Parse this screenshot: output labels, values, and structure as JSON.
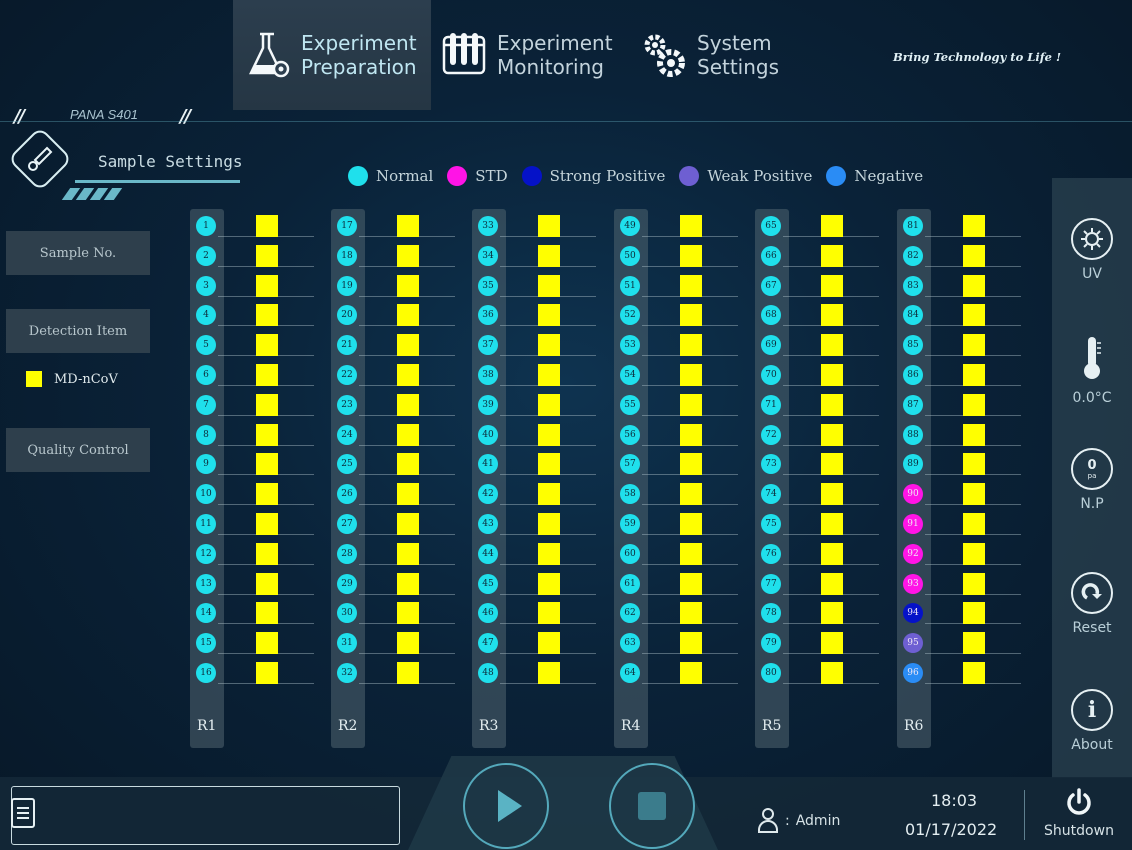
{
  "header": {
    "tabs": [
      {
        "label": "Experiment\nPreparation",
        "icon": "flask-gear-icon",
        "active": true
      },
      {
        "label": "Experiment\nMonitoring",
        "icon": "test-tube-rack-icon",
        "active": false
      },
      {
        "label": "System\nSettings",
        "icon": "gears-icon",
        "active": false
      }
    ],
    "slogan": "Bring Technology to Life !",
    "device": "PANA S401"
  },
  "section": {
    "title": "Sample Settings",
    "icon": "pipette-icon"
  },
  "legend": [
    {
      "label": "Normal",
      "color": "#1fe0ec"
    },
    {
      "label": "STD",
      "color": "#ff14e6"
    },
    {
      "label": "Strong Positive",
      "color": "#0512c8"
    },
    {
      "label": "Weak Positive",
      "color": "#6e5fd2"
    },
    {
      "label": "Negative",
      "color": "#2a8cf5"
    }
  ],
  "left_panel": {
    "sample_no": "Sample No.",
    "detection_item": "Detection Item",
    "detection_entry": {
      "label": "MD-nCoV",
      "color": "#ffff00"
    },
    "quality_control": "Quality Control"
  },
  "racks": [
    {
      "label": "R1",
      "slots": [
        "1",
        "2",
        "3",
        "4",
        "5",
        "6",
        "7",
        "8",
        "9",
        "10",
        "11",
        "12",
        "13",
        "14",
        "15",
        "16"
      ],
      "types": [
        "normal",
        "normal",
        "normal",
        "normal",
        "normal",
        "normal",
        "normal",
        "normal",
        "normal",
        "normal",
        "normal",
        "normal",
        "normal",
        "normal",
        "normal",
        "normal"
      ]
    },
    {
      "label": "R2",
      "slots": [
        "17",
        "18",
        "19",
        "20",
        "21",
        "22",
        "23",
        "24",
        "25",
        "26",
        "27",
        "28",
        "29",
        "30",
        "31",
        "32"
      ],
      "types": [
        "normal",
        "normal",
        "normal",
        "normal",
        "normal",
        "normal",
        "normal",
        "normal",
        "normal",
        "normal",
        "normal",
        "normal",
        "normal",
        "normal",
        "normal",
        "normal"
      ]
    },
    {
      "label": "R3",
      "slots": [
        "33",
        "34",
        "35",
        "36",
        "37",
        "38",
        "39",
        "40",
        "41",
        "42",
        "43",
        "44",
        "45",
        "46",
        "47",
        "48"
      ],
      "types": [
        "normal",
        "normal",
        "normal",
        "normal",
        "normal",
        "normal",
        "normal",
        "normal",
        "normal",
        "normal",
        "normal",
        "normal",
        "normal",
        "normal",
        "normal",
        "normal"
      ]
    },
    {
      "label": "R4",
      "slots": [
        "49",
        "50",
        "51",
        "52",
        "53",
        "54",
        "55",
        "56",
        "57",
        "58",
        "59",
        "60",
        "61",
        "62",
        "63",
        "64"
      ],
      "types": [
        "normal",
        "normal",
        "normal",
        "normal",
        "normal",
        "normal",
        "normal",
        "normal",
        "normal",
        "normal",
        "normal",
        "normal",
        "normal",
        "normal",
        "normal",
        "normal"
      ]
    },
    {
      "label": "R5",
      "slots": [
        "65",
        "66",
        "67",
        "68",
        "69",
        "70",
        "71",
        "72",
        "73",
        "74",
        "75",
        "76",
        "77",
        "78",
        "79",
        "80"
      ],
      "types": [
        "normal",
        "normal",
        "normal",
        "normal",
        "normal",
        "normal",
        "normal",
        "normal",
        "normal",
        "normal",
        "normal",
        "normal",
        "normal",
        "normal",
        "normal",
        "normal"
      ]
    },
    {
      "label": "R6",
      "slots": [
        "81",
        "82",
        "83",
        "84",
        "85",
        "86",
        "87",
        "88",
        "89",
        "90",
        "91",
        "92",
        "93",
        "94",
        "95",
        "96"
      ],
      "types": [
        "normal",
        "normal",
        "normal",
        "normal",
        "normal",
        "normal",
        "normal",
        "normal",
        "normal",
        "std",
        "std",
        "std",
        "std",
        "strong",
        "weak",
        "negative"
      ]
    }
  ],
  "right_panel": [
    {
      "label": "UV",
      "icon": "uv-lamp-icon"
    },
    {
      "label": "0.0°C",
      "icon": "thermometer-icon"
    },
    {
      "label": "N.P",
      "icon": "timer-icon",
      "value": "0",
      "unit": "pa"
    },
    {
      "label": "Reset",
      "icon": "reset-icon"
    },
    {
      "label": "About",
      "icon": "info-icon"
    }
  ],
  "bottom": {
    "user_sep": ":",
    "user": "Admin",
    "time": "18:03",
    "date": "01/17/2022",
    "shutdown": "Shutdown"
  },
  "colors": {
    "accent": "#5ab3c4",
    "cell": "#ffff00",
    "normal": "#1fe0ec",
    "std": "#ff14e6",
    "strong": "#0512c8",
    "weak": "#6e5fd2",
    "negative": "#2a8cf5"
  }
}
